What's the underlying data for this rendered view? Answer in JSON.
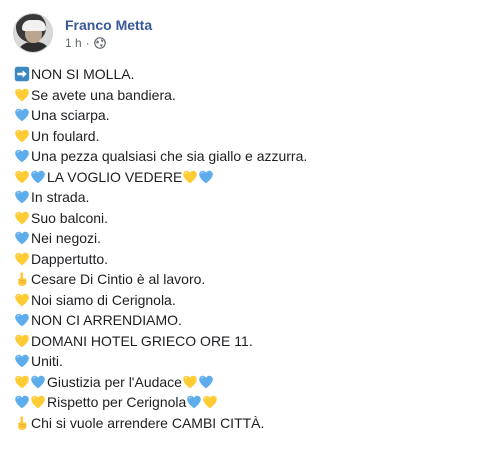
{
  "post": {
    "author": "Franco Metta",
    "time": "1 h",
    "separator": "·",
    "privacy_icon": "globe-icon"
  },
  "colors": {
    "author": "#385898",
    "meta": "#616770",
    "yellow_heart": "#FFCC33",
    "blue_heart": "#5DADEC",
    "arrow_box": "#3B88C3"
  },
  "lines": [
    {
      "icons_before": [
        "arrow-right-icon"
      ],
      "text": "NON SI MOLLA.",
      "icons_after": []
    },
    {
      "icons_before": [
        "yellow-heart-icon"
      ],
      "text": "Se avete una bandiera.",
      "icons_after": []
    },
    {
      "icons_before": [
        "blue-heart-icon"
      ],
      "text": "Una sciarpa.",
      "icons_after": []
    },
    {
      "icons_before": [
        "yellow-heart-icon"
      ],
      "text": "Un foulard.",
      "icons_after": []
    },
    {
      "icons_before": [
        "blue-heart-icon"
      ],
      "text": "Una pezza qualsiasi che sia giallo e azzurra.",
      "icons_after": []
    },
    {
      "icons_before": [
        "yellow-heart-icon",
        "blue-heart-icon"
      ],
      "text": "LA VOGLIO VEDERE",
      "icons_after": [
        "yellow-heart-icon",
        "blue-heart-icon"
      ]
    },
    {
      "icons_before": [
        "blue-heart-icon"
      ],
      "text": "In strada.",
      "icons_after": []
    },
    {
      "icons_before": [
        "yellow-heart-icon"
      ],
      "text": "Suo balconi.",
      "icons_after": []
    },
    {
      "icons_before": [
        "blue-heart-icon"
      ],
      "text": "Nei negozi.",
      "icons_after": []
    },
    {
      "icons_before": [
        "yellow-heart-icon"
      ],
      "text": "Dappertutto.",
      "icons_after": []
    },
    {
      "icons_before": [
        "pointing-up-hand-icon"
      ],
      "text": "Cesare Di Cintio è al lavoro.",
      "icons_after": []
    },
    {
      "icons_before": [
        "yellow-heart-icon"
      ],
      "text": "Noi siamo di Cerignola.",
      "icons_after": []
    },
    {
      "icons_before": [
        "blue-heart-icon"
      ],
      "text": "NON CI ARRENDIAMO.",
      "icons_after": []
    },
    {
      "icons_before": [
        "yellow-heart-icon"
      ],
      "text": "DOMANI HOTEL GRIECO ORE 11.",
      "icons_after": []
    },
    {
      "icons_before": [
        "blue-heart-icon"
      ],
      "text": "Uniti.",
      "icons_after": []
    },
    {
      "icons_before": [
        "yellow-heart-icon",
        "blue-heart-icon"
      ],
      "text": "Giustizia per l'Audace",
      "icons_after": [
        "yellow-heart-icon",
        "blue-heart-icon"
      ]
    },
    {
      "icons_before": [
        "blue-heart-icon",
        "yellow-heart-icon"
      ],
      "text": "Rispetto per Cerignola",
      "icons_after": [
        "blue-heart-icon",
        "yellow-heart-icon"
      ]
    },
    {
      "icons_before": [
        "pointing-up-hand-icon"
      ],
      "text": "Chi si vuole arrendere CAMBI CITTÀ.",
      "icons_after": []
    }
  ]
}
